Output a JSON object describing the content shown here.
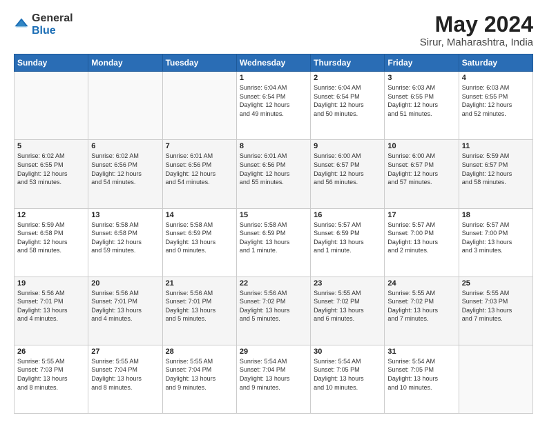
{
  "header": {
    "logo_general": "General",
    "logo_blue": "Blue",
    "main_title": "May 2024",
    "subtitle": "Sirur, Maharashtra, India"
  },
  "calendar": {
    "days_of_week": [
      "Sunday",
      "Monday",
      "Tuesday",
      "Wednesday",
      "Thursday",
      "Friday",
      "Saturday"
    ],
    "weeks": [
      [
        {
          "day": "",
          "info": ""
        },
        {
          "day": "",
          "info": ""
        },
        {
          "day": "",
          "info": ""
        },
        {
          "day": "1",
          "info": "Sunrise: 6:04 AM\nSunset: 6:54 PM\nDaylight: 12 hours\nand 49 minutes."
        },
        {
          "day": "2",
          "info": "Sunrise: 6:04 AM\nSunset: 6:54 PM\nDaylight: 12 hours\nand 50 minutes."
        },
        {
          "day": "3",
          "info": "Sunrise: 6:03 AM\nSunset: 6:55 PM\nDaylight: 12 hours\nand 51 minutes."
        },
        {
          "day": "4",
          "info": "Sunrise: 6:03 AM\nSunset: 6:55 PM\nDaylight: 12 hours\nand 52 minutes."
        }
      ],
      [
        {
          "day": "5",
          "info": "Sunrise: 6:02 AM\nSunset: 6:55 PM\nDaylight: 12 hours\nand 53 minutes."
        },
        {
          "day": "6",
          "info": "Sunrise: 6:02 AM\nSunset: 6:56 PM\nDaylight: 12 hours\nand 54 minutes."
        },
        {
          "day": "7",
          "info": "Sunrise: 6:01 AM\nSunset: 6:56 PM\nDaylight: 12 hours\nand 54 minutes."
        },
        {
          "day": "8",
          "info": "Sunrise: 6:01 AM\nSunset: 6:56 PM\nDaylight: 12 hours\nand 55 minutes."
        },
        {
          "day": "9",
          "info": "Sunrise: 6:00 AM\nSunset: 6:57 PM\nDaylight: 12 hours\nand 56 minutes."
        },
        {
          "day": "10",
          "info": "Sunrise: 6:00 AM\nSunset: 6:57 PM\nDaylight: 12 hours\nand 57 minutes."
        },
        {
          "day": "11",
          "info": "Sunrise: 5:59 AM\nSunset: 6:57 PM\nDaylight: 12 hours\nand 58 minutes."
        }
      ],
      [
        {
          "day": "12",
          "info": "Sunrise: 5:59 AM\nSunset: 6:58 PM\nDaylight: 12 hours\nand 58 minutes."
        },
        {
          "day": "13",
          "info": "Sunrise: 5:58 AM\nSunset: 6:58 PM\nDaylight: 12 hours\nand 59 minutes."
        },
        {
          "day": "14",
          "info": "Sunrise: 5:58 AM\nSunset: 6:59 PM\nDaylight: 13 hours\nand 0 minutes."
        },
        {
          "day": "15",
          "info": "Sunrise: 5:58 AM\nSunset: 6:59 PM\nDaylight: 13 hours\nand 1 minute."
        },
        {
          "day": "16",
          "info": "Sunrise: 5:57 AM\nSunset: 6:59 PM\nDaylight: 13 hours\nand 1 minute."
        },
        {
          "day": "17",
          "info": "Sunrise: 5:57 AM\nSunset: 7:00 PM\nDaylight: 13 hours\nand 2 minutes."
        },
        {
          "day": "18",
          "info": "Sunrise: 5:57 AM\nSunset: 7:00 PM\nDaylight: 13 hours\nand 3 minutes."
        }
      ],
      [
        {
          "day": "19",
          "info": "Sunrise: 5:56 AM\nSunset: 7:01 PM\nDaylight: 13 hours\nand 4 minutes."
        },
        {
          "day": "20",
          "info": "Sunrise: 5:56 AM\nSunset: 7:01 PM\nDaylight: 13 hours\nand 4 minutes."
        },
        {
          "day": "21",
          "info": "Sunrise: 5:56 AM\nSunset: 7:01 PM\nDaylight: 13 hours\nand 5 minutes."
        },
        {
          "day": "22",
          "info": "Sunrise: 5:56 AM\nSunset: 7:02 PM\nDaylight: 13 hours\nand 5 minutes."
        },
        {
          "day": "23",
          "info": "Sunrise: 5:55 AM\nSunset: 7:02 PM\nDaylight: 13 hours\nand 6 minutes."
        },
        {
          "day": "24",
          "info": "Sunrise: 5:55 AM\nSunset: 7:02 PM\nDaylight: 13 hours\nand 7 minutes."
        },
        {
          "day": "25",
          "info": "Sunrise: 5:55 AM\nSunset: 7:03 PM\nDaylight: 13 hours\nand 7 minutes."
        }
      ],
      [
        {
          "day": "26",
          "info": "Sunrise: 5:55 AM\nSunset: 7:03 PM\nDaylight: 13 hours\nand 8 minutes."
        },
        {
          "day": "27",
          "info": "Sunrise: 5:55 AM\nSunset: 7:04 PM\nDaylight: 13 hours\nand 8 minutes."
        },
        {
          "day": "28",
          "info": "Sunrise: 5:55 AM\nSunset: 7:04 PM\nDaylight: 13 hours\nand 9 minutes."
        },
        {
          "day": "29",
          "info": "Sunrise: 5:54 AM\nSunset: 7:04 PM\nDaylight: 13 hours\nand 9 minutes."
        },
        {
          "day": "30",
          "info": "Sunrise: 5:54 AM\nSunset: 7:05 PM\nDaylight: 13 hours\nand 10 minutes."
        },
        {
          "day": "31",
          "info": "Sunrise: 5:54 AM\nSunset: 7:05 PM\nDaylight: 13 hours\nand 10 minutes."
        },
        {
          "day": "",
          "info": ""
        }
      ]
    ]
  }
}
